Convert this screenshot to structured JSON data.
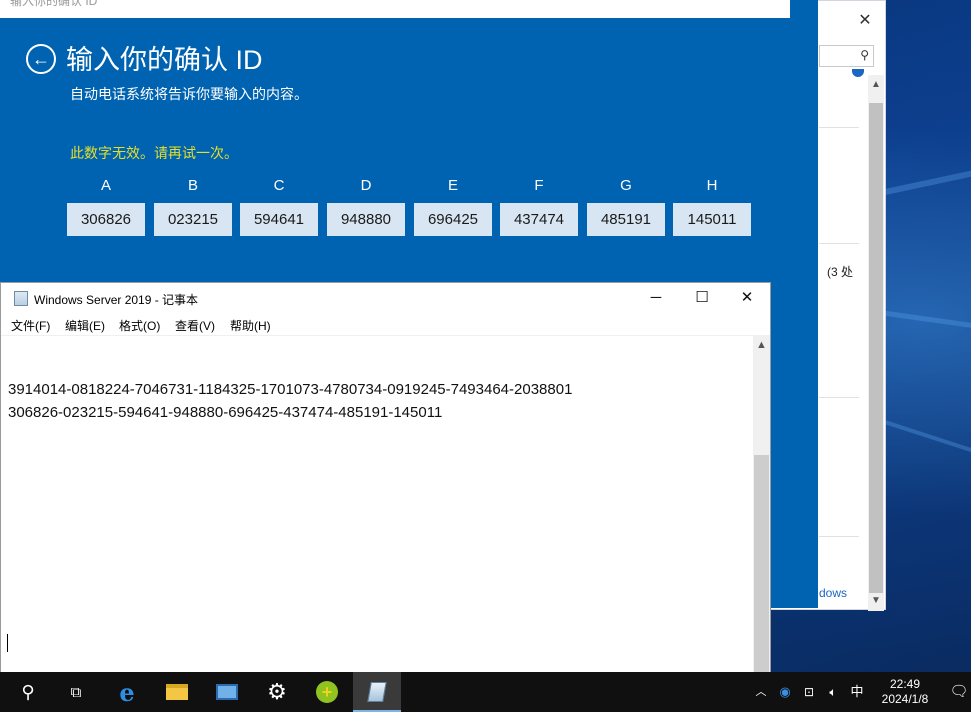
{
  "activation": {
    "window_title": "输入你的确认 ID",
    "title": "输入你的确认 ID",
    "subtitle": "自动电话系统将告诉你要输入的内容。",
    "error": "此数字无效。请再试一次。",
    "columns": [
      {
        "label": "A",
        "value": "306826"
      },
      {
        "label": "B",
        "value": "023215"
      },
      {
        "label": "C",
        "value": "594641"
      },
      {
        "label": "D",
        "value": "948880"
      },
      {
        "label": "E",
        "value": "696425"
      },
      {
        "label": "F",
        "value": "437474"
      },
      {
        "label": "G",
        "value": "485191"
      },
      {
        "label": "H",
        "value": "145011"
      }
    ]
  },
  "back_window": {
    "close_glyph": "✕",
    "text_fragment": "(3 处",
    "link_fragment": "dows"
  },
  "notepad": {
    "title": "Windows Server 2019 - 记事本",
    "menu": [
      "文件(F)",
      "编辑(E)",
      "格式(O)",
      "查看(V)",
      "帮助(H)"
    ],
    "lines": [
      "3914014-0818224-7046731-1184325-1701073-4780734-0919245-7493464-2038801",
      "306826-023215-594641-948880-696425-437474-485191-145011"
    ]
  },
  "taskbar": {
    "input_indicator": "中",
    "time": "22:49",
    "date": "2024/1/8"
  },
  "colors": {
    "activation_bg": "#0063b1",
    "error_text": "#e3e02a",
    "code_box_bg": "#d8e6f3"
  }
}
